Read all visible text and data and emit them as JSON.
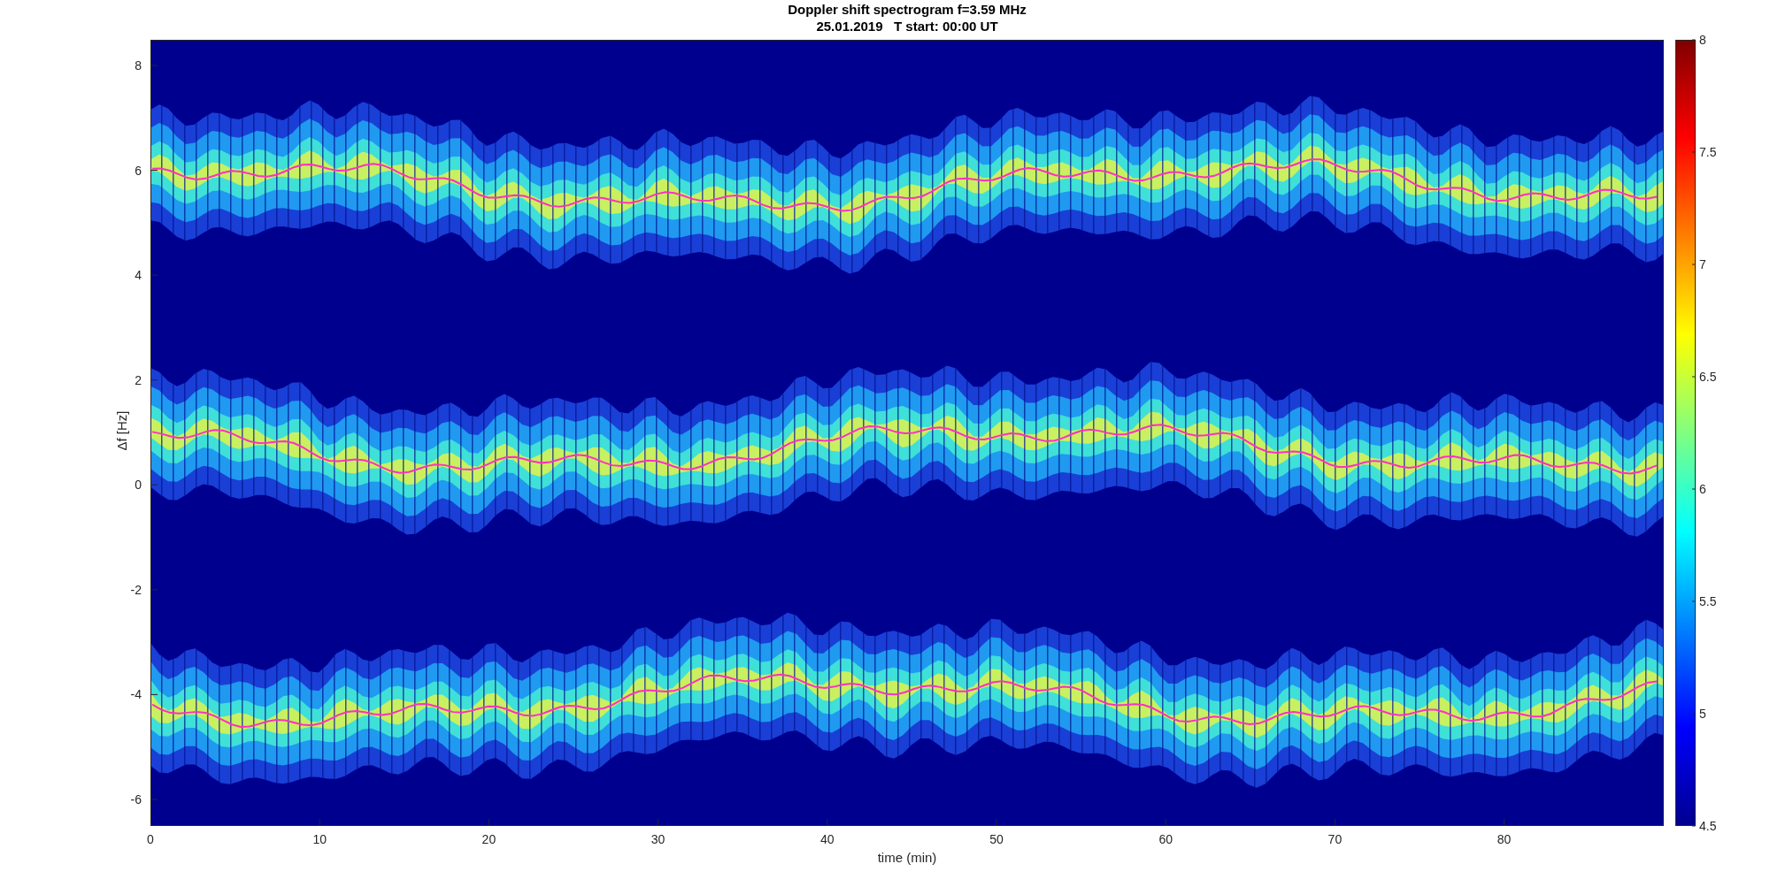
{
  "title": [
    "Doppler shift spectrogram f=3.59 MHz",
    "25.01.2019   T start: 00:00 UT"
  ],
  "y_axis": {
    "label": "Δf [Hz]",
    "ticks": [
      "8",
      "6",
      "4",
      "2",
      "0",
      "-2",
      "-4",
      "-6"
    ]
  },
  "x_axis": {
    "label": "time (min)",
    "ticks": [
      "0",
      "10",
      "20",
      "30",
      "40",
      "50",
      "60",
      "70",
      "80"
    ]
  },
  "colorbar": {
    "ticks": [
      "8",
      "7.5",
      "7",
      "6.5",
      "6",
      "5.5",
      "5",
      "4.5"
    ]
  }
}
